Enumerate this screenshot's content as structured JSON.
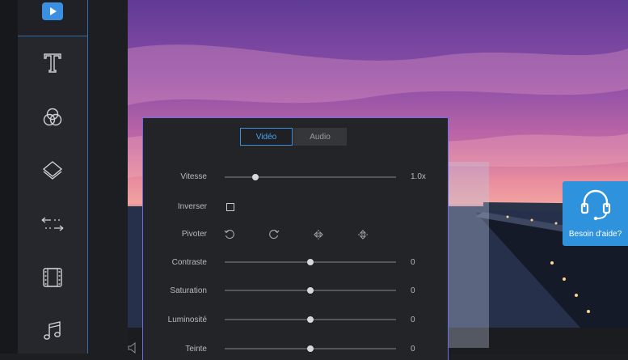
{
  "sidebar": {
    "items": [
      {
        "icon": "text-icon"
      },
      {
        "icon": "filters-icon"
      },
      {
        "icon": "overlays-icon"
      },
      {
        "icon": "transitions-icon"
      },
      {
        "icon": "elements-icon"
      },
      {
        "icon": "music-icon"
      }
    ]
  },
  "panel": {
    "tabs": [
      {
        "label": "Vidéo",
        "active": true
      },
      {
        "label": "Audio",
        "active": false
      }
    ],
    "speed": {
      "label": "Vitesse",
      "value": "1.0x",
      "level": 0.18
    },
    "reverse": {
      "label": "Inverser",
      "checked": false
    },
    "rotate": {
      "label": "Pivoter",
      "icons": [
        "rotate-left-icon",
        "rotate-right-icon",
        "flip-horizontal-icon",
        "flip-vertical-icon"
      ]
    },
    "contrast": {
      "label": "Contraste",
      "value": "0",
      "level": 0.5
    },
    "saturation": {
      "label": "Saturation",
      "value": "0",
      "level": 0.5
    },
    "brightness": {
      "label": "Luminosité",
      "value": "0",
      "level": 0.5
    },
    "hue": {
      "label": "Teinte",
      "value": "0",
      "level": 0.5
    }
  },
  "help": {
    "label": "Besoin d'aide?"
  },
  "colors": {
    "accent": "#3a8fe0",
    "panel_border": "#6c6de8",
    "help_bg": "#2f92dd"
  }
}
